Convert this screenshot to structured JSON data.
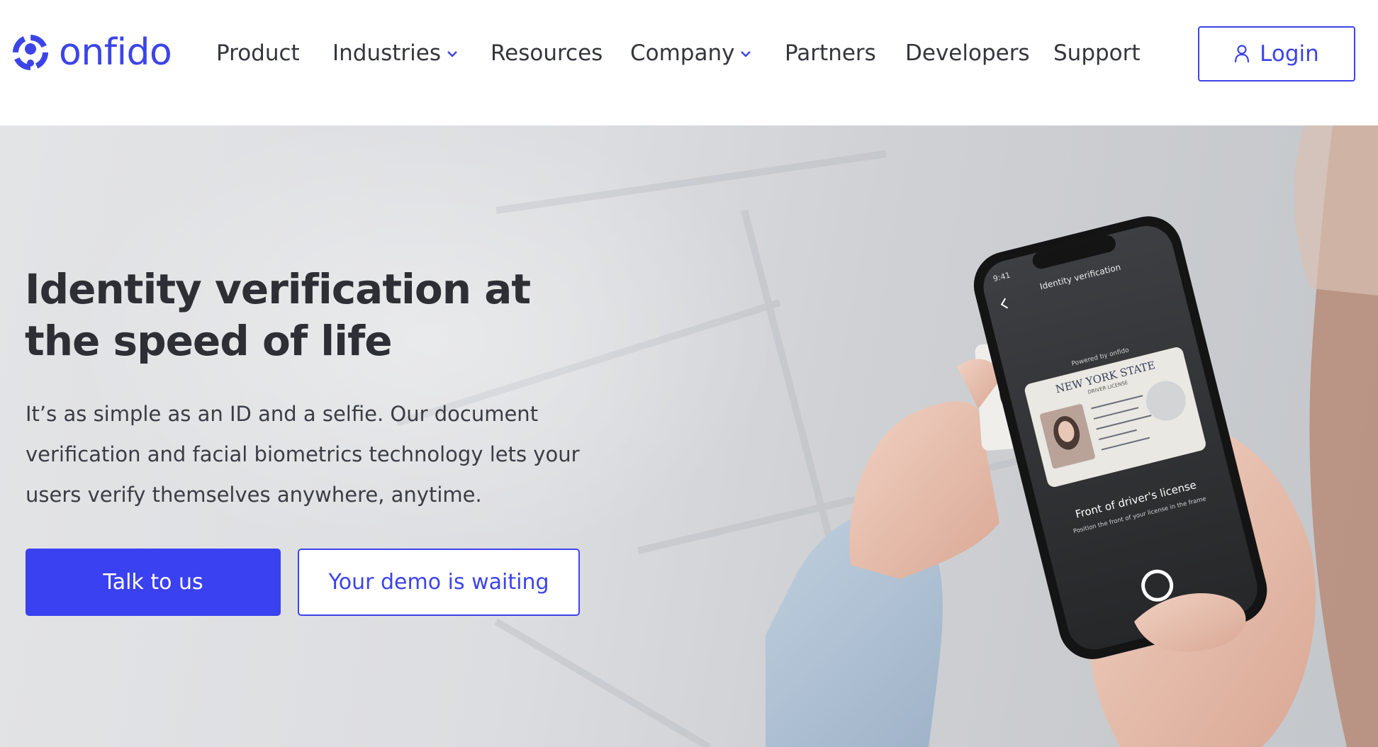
{
  "brand": {
    "name": "onfido",
    "accent": "#3c44e8"
  },
  "nav": {
    "items": [
      {
        "label": "Product",
        "dropdown": false
      },
      {
        "label": "Industries",
        "dropdown": true
      },
      {
        "label": "Resources",
        "dropdown": false
      },
      {
        "label": "Company",
        "dropdown": true
      },
      {
        "label": "Partners",
        "dropdown": false
      },
      {
        "label": "Developers",
        "dropdown": false
      },
      {
        "label": "Support",
        "dropdown": false
      }
    ],
    "login_label": "Login",
    "login_icon": "user-icon"
  },
  "hero": {
    "headline": "Identity verification at the speed of life",
    "subtext": "It’s as simple as an ID and a selfie. Our document verification and facial biometrics technology lets your users verify themselves anywhere, anytime.",
    "primary_cta": "Talk to us",
    "secondary_cta": "Your demo is waiting",
    "primary_color": "#3a41f0"
  },
  "phone_screen": {
    "time": "9:41",
    "title": "Identity verification",
    "powered_by": "Powered by onfido",
    "card_state": "NEW YORK STATE",
    "card_subtitle": "DRIVER LICENSE",
    "instruction_title": "Front of driver's license",
    "instruction_text": "Position the front of your license in the frame"
  }
}
